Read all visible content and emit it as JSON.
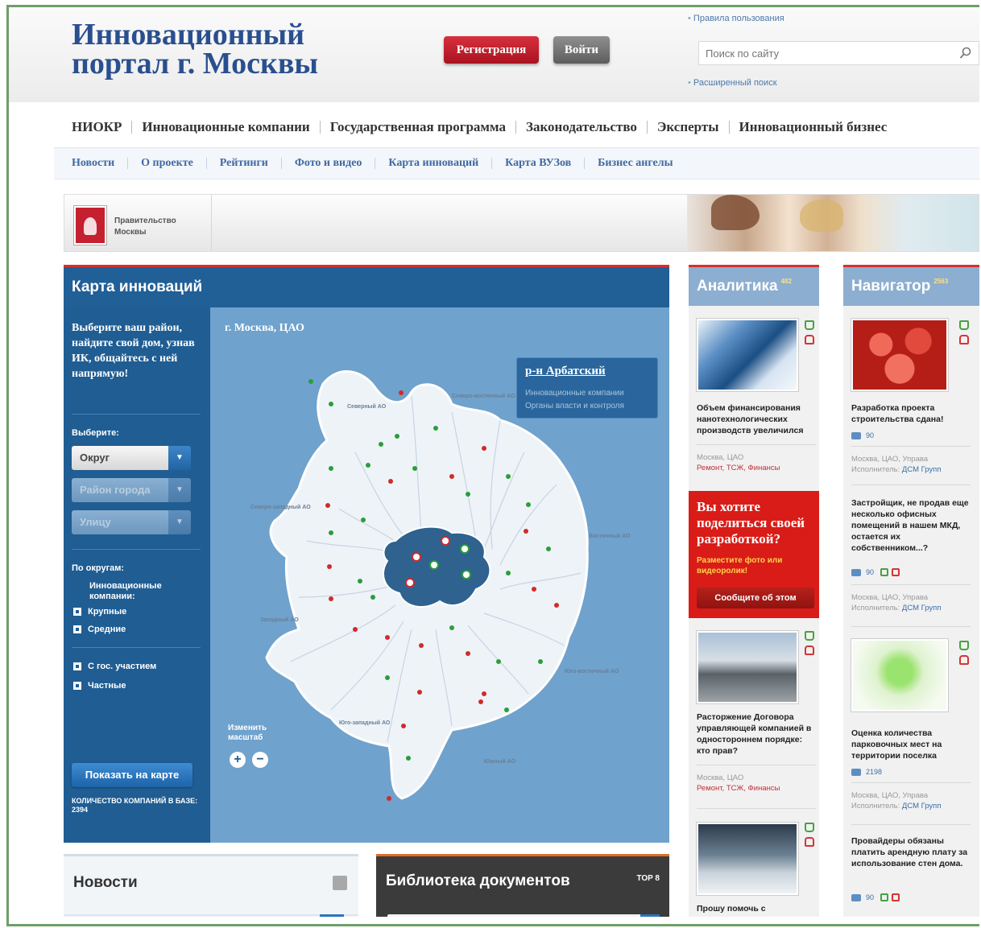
{
  "header": {
    "site_title_line1": "Инновационный",
    "site_title_line2": "портал г. Москвы",
    "register_label": "Регистрация",
    "login_label": "Войти",
    "rules_link": "Правила пользования",
    "search_placeholder": "Поиск по сайту",
    "advanced_search": "Расширенный поиск"
  },
  "main_nav": [
    "НИОКР",
    "Инновационные компании",
    "Государственная программа",
    "Законодательство",
    "Эксперты",
    "Инновационный бизнес"
  ],
  "sub_nav": [
    "Новости",
    "О проекте",
    "Рейтинги",
    "Фото и видео",
    "Карта инноваций",
    "Карта ВУЗов",
    "Бизнес ангелы"
  ],
  "banner": {
    "gov_line1": "Правительство",
    "gov_line2": "Москвы"
  },
  "map": {
    "title": "Карта инноваций",
    "intro": "Выберите ваш район, найдите свой дом, узнав ИК, общайтесь с ней напрямую!",
    "select_label": "Выберите:",
    "select_okrug": "Округ",
    "select_district": "Район города",
    "select_street": "Улицу",
    "by_okrug_label": "По округам:",
    "innovative_companies": "Инновационные компании:",
    "filter_large": "Крупные",
    "filter_medium": "Средние",
    "filter_state": "С гос. участием",
    "filter_private": "Частные",
    "show_button": "Показать на карте",
    "count_text": "Количество компаний в базе: 2394",
    "location": "г. Москва, ЦАО",
    "info_title": "р-н Арбатский",
    "info_line1": "Инновационные компании",
    "info_line2": "Органы власти и контроля",
    "scale_label_1": "Изменить",
    "scale_label_2": "масштаб",
    "zoom_in": "+",
    "zoom_out": "−",
    "okrug_labels": {
      "north": "Северный АО",
      "north_east": "Северо-восточный АО",
      "north_west": "Северо-западный АО",
      "east": "Восточный АО",
      "west": "Западный АО",
      "south_east": "Юго-восточный АО",
      "south_west": "Юго-западный АО",
      "south": "Южный АО"
    }
  },
  "news": {
    "title": "Новости"
  },
  "library": {
    "title": "Библиотека документов",
    "top": "TOP 8"
  },
  "analytics": {
    "title": "Аналитика",
    "count": "482",
    "card1_text": "Объем финансирования нанотехнологических производств увеличился",
    "card1_loc": "Москва, ЦАО",
    "card1_tags": "Ремонт, ТСЖ, Финансы",
    "share_title": "Вы хотите поделиться своей разработкой?",
    "share_sub": "Разместите фото или видеоролик!",
    "share_button": "Сообщите об этом",
    "card2_text": "Расторжение Договора управляющей компанией в одностороннем порядке: кто прав?",
    "card2_loc": "Москва, ЦАО",
    "card2_tags": "Ремонт, ТСЖ, Финансы",
    "card3_text": "Прошу помочь с разъяснением..."
  },
  "navigator": {
    "title": "Навигатор",
    "count": "2563",
    "card1_text": "Разработка проекта строительства сдана!",
    "card1_comments": "90",
    "card1_loc": "Москва, ЦАО, Управа",
    "card1_exec_label": "Исполнитель:",
    "card1_exec": "ДСМ Групп",
    "card2_text": "Застройщик, не продав еще несколько офисных помещений в нашем МКД, остается их собственником...?",
    "card2_comments": "90",
    "card2_loc": "Москва, ЦАО, Управа",
    "card2_exec_label": "Исполнитель:",
    "card2_exec": "ДСМ Групп",
    "card3_text": "Оценка количества парковочных мест на территории поселка",
    "card3_comments": "2198",
    "card3_loc": "Москва, ЦАО, Управа",
    "card3_exec_label": "Исполнитель:",
    "card3_exec": "ДСМ Групп",
    "card4_text": "Провайдеры обязаны платить арендную плату за использование стен дома.",
    "card4_comments": "90"
  },
  "colors": {
    "brand_blue": "#2a4f8f",
    "map_dark": "#215f97",
    "map_light": "#6fa2cd",
    "accent_red": "#d7302f",
    "dot_red": "#d22a2a",
    "dot_green": "#2a9e3a"
  }
}
